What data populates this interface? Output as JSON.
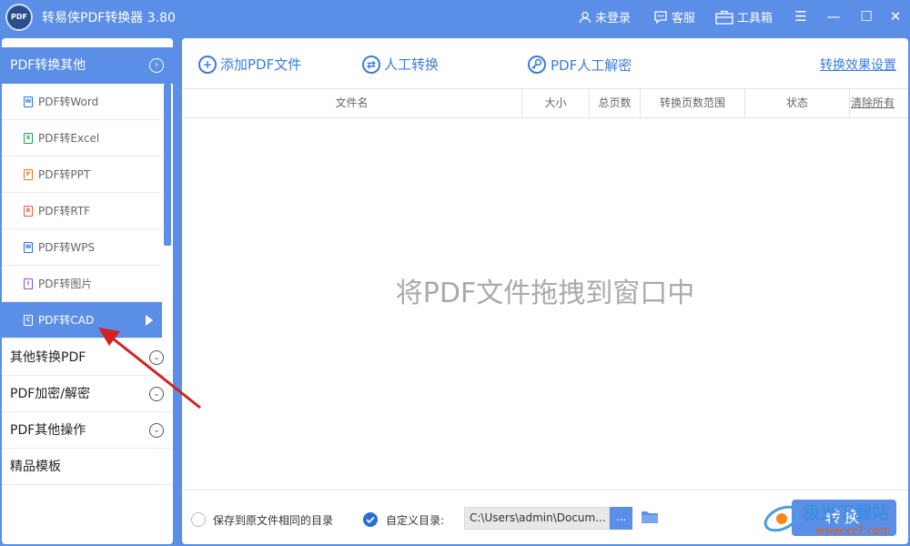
{
  "colors": {
    "primary": "#5b8ee6",
    "link": "#3a7be0",
    "arrow": "#d42020"
  },
  "title_bar": {
    "app_title": "转易侠PDF转换器 3.80",
    "logo": "PDF",
    "login": "未登录",
    "support": "客服",
    "toolbox": "工具箱"
  },
  "sidebar": {
    "active_category": "PDF转换其他",
    "sub_items": [
      {
        "label": "PDF转Word",
        "icon": "word-file-icon",
        "color": "#2b7cd3",
        "glyph": "W"
      },
      {
        "label": "PDF转Excel",
        "icon": "excel-file-icon",
        "color": "#1e9e52",
        "glyph": "X"
      },
      {
        "label": "PDF转PPT",
        "icon": "ppt-file-icon",
        "color": "#e8742a",
        "glyph": "P"
      },
      {
        "label": "PDF转RTF",
        "icon": "rtf-file-icon",
        "color": "#e85a3a",
        "glyph": "R"
      },
      {
        "label": "PDF转WPS",
        "icon": "wps-file-icon",
        "color": "#2b6fd3",
        "glyph": "W"
      },
      {
        "label": "PDF转图片",
        "icon": "image-file-icon",
        "color": "#8a4fd0",
        "glyph": "I"
      },
      {
        "label": "PDF转CAD",
        "icon": "cad-file-icon",
        "color": "#ffffff",
        "glyph": "C",
        "active": true
      }
    ],
    "categories": [
      {
        "label": "其他转换PDF",
        "expandable": true
      },
      {
        "label": "PDF加密/解密",
        "expandable": true
      },
      {
        "label": "PDF其他操作",
        "expandable": true
      },
      {
        "label": "精品模板",
        "expandable": false
      }
    ]
  },
  "toolbar": {
    "add_file": "添加PDF文件",
    "manual_convert": "人工转换",
    "manual_decrypt": "PDF人工解密",
    "settings_link": "转换效果设置"
  },
  "table": {
    "columns": [
      "文件名",
      "大小",
      "总页数",
      "转换页数范围",
      "状态"
    ],
    "clear_all": "清除所有"
  },
  "drop_hint": "将PDF文件拖拽到窗口中",
  "footer": {
    "save_same_dir": "保存到原文件相同的目录",
    "custom_dir": "自定义目录:",
    "path": "C:\\Users\\admin\\Docum...",
    "browse": "...",
    "convert": "转换"
  },
  "watermark": {
    "text": "极光下载站",
    "url": "www.xz7.com"
  }
}
